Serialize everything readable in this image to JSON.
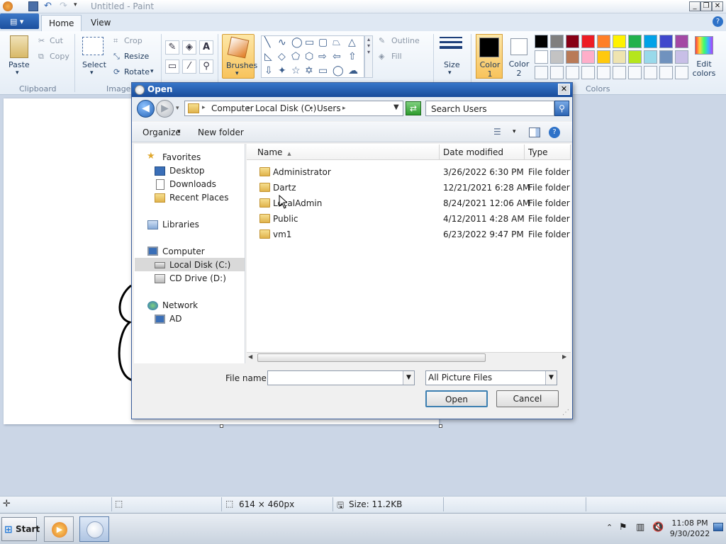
{
  "window": {
    "title": "Untitled - Paint"
  },
  "ribbon_tabs": {
    "home": "Home",
    "view": "View"
  },
  "clipboard": {
    "paste": "Paste",
    "cut": "Cut",
    "copy": "Copy",
    "group": "Clipboard"
  },
  "image": {
    "select": "Select",
    "crop": "Crop",
    "resize": "Resize",
    "rotate": "Rotate",
    "group": "Image"
  },
  "tools": {
    "brushes": "Brushes"
  },
  "shapes": {
    "outline": "Outline",
    "fill": "Fill"
  },
  "size": {
    "label": "Size"
  },
  "colors": {
    "color1": "Color 1",
    "color2": "Color 2",
    "edit": "Edit colors",
    "group": "Colors",
    "palette": [
      "#000000",
      "#7f7f7f",
      "#880015",
      "#ed1c24",
      "#ff7f27",
      "#fff200",
      "#22b14c",
      "#00a2e8",
      "#3f48cc",
      "#a349a4",
      "#ffffff",
      "#c3c3c3",
      "#b97a57",
      "#ffaec9",
      "#ffc90e",
      "#efe4b0",
      "#b5e61d",
      "#99d9ea",
      "#7092be",
      "#c8bfe7"
    ]
  },
  "status": {
    "dimensions": "614 × 460px",
    "size": "Size: 11.2KB"
  },
  "dialog": {
    "title": "Open",
    "breadcrumb": [
      "Computer",
      "Local Disk (C:)",
      "Users"
    ],
    "search_placeholder": "Search Users",
    "toolbar": {
      "organize": "Organize",
      "new_folder": "New folder"
    },
    "nav": {
      "favorites": "Favorites",
      "desktop": "Desktop",
      "downloads": "Downloads",
      "recent": "Recent Places",
      "libraries": "Libraries",
      "computer": "Computer",
      "local_disk": "Local Disk (C:)",
      "cd_drive": "CD Drive (D:)",
      "network": "Network",
      "ad": "AD"
    },
    "columns": {
      "name": "Name",
      "date": "Date modified",
      "type": "Type"
    },
    "files": [
      {
        "name": "Administrator",
        "date": "3/26/2022 6:30 PM",
        "type": "File folder"
      },
      {
        "name": "Dartz",
        "date": "12/21/2021 6:28 AM",
        "type": "File folder"
      },
      {
        "name": "LocalAdmin",
        "date": "8/24/2021 12:06 AM",
        "type": "File folder"
      },
      {
        "name": "Public",
        "date": "4/12/2011 4:28 AM",
        "type": "File folder"
      },
      {
        "name": "vm1",
        "date": "6/23/2022 9:47 PM",
        "type": "File folder"
      }
    ],
    "filename_label": "File name:",
    "filename_value": "",
    "filetype": "All Picture Files",
    "open_button": "Open",
    "cancel_button": "Cancel"
  },
  "taskbar": {
    "start": "Start",
    "time": "11:08 PM",
    "date": "9/30/2022"
  }
}
